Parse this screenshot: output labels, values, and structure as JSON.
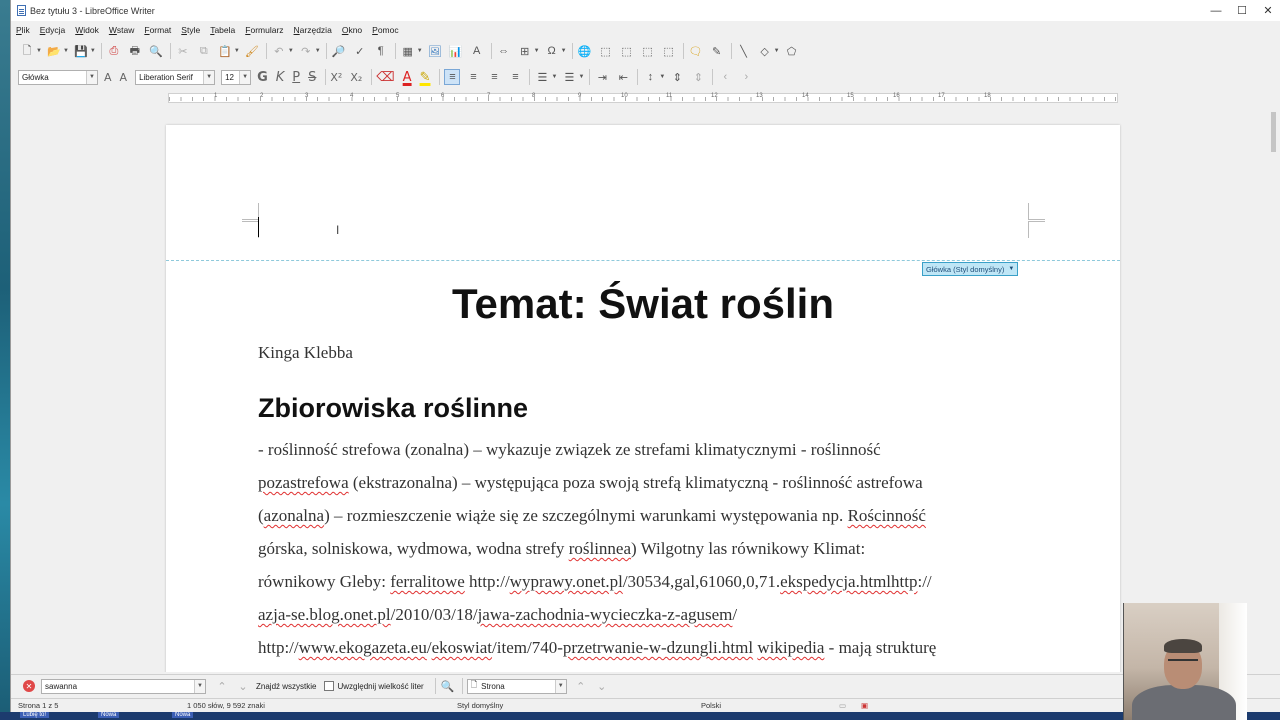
{
  "window": {
    "title": "Bez tytułu 3 - LibreOffice Writer",
    "controls": [
      "—",
      "☐",
      "✕"
    ]
  },
  "menu": [
    "Plik",
    "Edycja",
    "Widok",
    "Wstaw",
    "Format",
    "Style",
    "Tabela",
    "Formularz",
    "Narzędzia",
    "Okno",
    "Pomoc"
  ],
  "formatting": {
    "paragraph_style": "Główka",
    "font_name": "Liberation Serif",
    "font_size": "12",
    "bold": "G",
    "italic": "K",
    "underline": "P",
    "strike": "S",
    "superscript": "X²",
    "subscript": "X₂"
  },
  "ruler": {
    "labels": [
      "1",
      "2",
      "3",
      "4",
      "5",
      "6",
      "7",
      "8",
      "9",
      "10",
      "11",
      "12",
      "13",
      "14",
      "15",
      "16",
      "17",
      "18"
    ]
  },
  "page": {
    "header_tag": "Główka (Styl domyślny)",
    "title": "Temat: Świat roślin",
    "author": "Kinga Klebba",
    "heading": "Zbiorowiska roślinne",
    "body_lines": [
      [
        {
          "t": "- roślinność strefowa (zonalna) – wykazuje związek ze strefami klimatycznymi - roślinność"
        }
      ],
      [
        {
          "t": "pozastrefowa",
          "sp": true
        },
        {
          "t": " (ekstrazonalna) – występująca poza swoją strefą klimatyczną - roślinność astrefowa"
        }
      ],
      [
        {
          "t": "("
        },
        {
          "t": "azonalna",
          "sp": true
        },
        {
          "t": ") – rozmieszczenie wiąże się ze szczególnymi warunkami występowania np. "
        },
        {
          "t": "Rościnność",
          "sp": true
        }
      ],
      [
        {
          "t": "górska, solniskowa, wydmowa, wodna strefy "
        },
        {
          "t": "roślinnea",
          "sp": true
        },
        {
          "t": ") Wilgotny las równikowy Klimat:"
        }
      ],
      [
        {
          "t": "równikowy Gleby: "
        },
        {
          "t": "ferralitowe",
          "sp": true
        },
        {
          "t": " http://"
        },
        {
          "t": "wyprawy.onet.pl",
          "sp": true
        },
        {
          "t": "/30534,gal,61060,0,71."
        },
        {
          "t": "ekspedycja.htmlhttp",
          "sp": true
        },
        {
          "t": "://"
        }
      ],
      [
        {
          "t": "azja-se.blog.onet.pl",
          "sp": true
        },
        {
          "t": "/2010/03/18/"
        },
        {
          "t": "jawa-zachodnia-wycieczka-z-agusem",
          "sp": true
        },
        {
          "t": "/"
        }
      ],
      [
        {
          "t": "http://"
        },
        {
          "t": "www.ekogazeta.eu",
          "sp": true
        },
        {
          "t": "/"
        },
        {
          "t": "ekoswiat",
          "sp": true
        },
        {
          "t": "/item/740-"
        },
        {
          "t": "przetrwanie-w-dzungli.html",
          "sp": true
        },
        {
          "t": " "
        },
        {
          "t": "wikipedia",
          "sp": true
        },
        {
          "t": " - mają strukturę"
        }
      ]
    ]
  },
  "findbar": {
    "search_value": "sawanna",
    "find_all": "Znajdź wszystkie",
    "match_case": "Uwzględnij wielkość liter",
    "scope": "Strona"
  },
  "status": {
    "page": "Strona 1 z 5",
    "words": "1 050 słów, 9 592 znaki",
    "style": "Styl domyślny",
    "language": "Polski"
  },
  "taskbar": {
    "items": [
      "Lubię to!",
      "Nowa",
      "Nowa"
    ]
  }
}
